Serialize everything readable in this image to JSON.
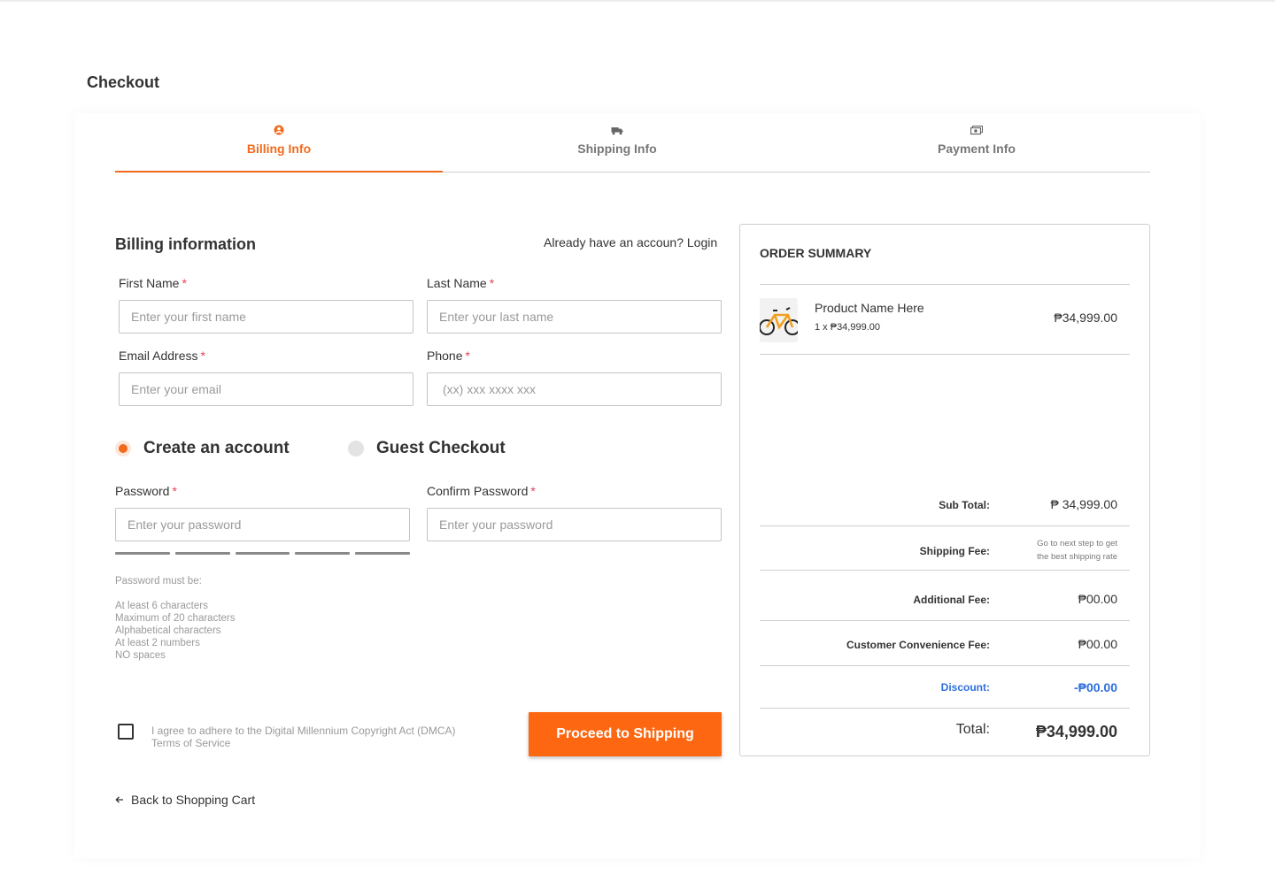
{
  "page": {
    "title": "Checkout"
  },
  "steps": [
    {
      "label": "Billing Info",
      "icon": "user-circle-icon",
      "active": true
    },
    {
      "label": "Shipping Info",
      "icon": "truck-icon",
      "active": false
    },
    {
      "label": "Payment Info",
      "icon": "cash-icon",
      "active": false
    }
  ],
  "colors": {
    "accent": "#f26b1d",
    "button": "#fe6712",
    "discount": "#2f6fdd",
    "required": "#e2445c"
  },
  "billing": {
    "heading": "Billing information",
    "login_prompt": "Already have an accoun? Login",
    "first_name": {
      "label": "First Name",
      "placeholder": "Enter your first name",
      "value": ""
    },
    "last_name": {
      "label": "Last Name",
      "placeholder": "Enter your last name",
      "value": ""
    },
    "email": {
      "label": "Email Address",
      "placeholder": "Enter your email",
      "value": ""
    },
    "phone": {
      "label": "Phone",
      "placeholder": "(xx) xxx xxxx xxx",
      "value": ""
    },
    "required_mark": "*",
    "account_options": [
      {
        "label": "Create an account",
        "selected": true
      },
      {
        "label": "Guest Checkout",
        "selected": false
      }
    ],
    "password": {
      "label": "Password",
      "placeholder": "Enter your password",
      "value": ""
    },
    "confirm_password": {
      "label": "Confirm Password",
      "placeholder": "Enter your password",
      "value": ""
    },
    "password_rules": {
      "title": "Password must be:",
      "items": [
        "At least 6 characters",
        "Maximum of 20 characters",
        "Alphabetical characters",
        "At least 2 numbers",
        "NO spaces"
      ]
    },
    "agreement": {
      "line1": "I agree to adhere to the Digital Millennium Copyright Act (DMCA)",
      "line2": "Terms of Service",
      "checked": false
    },
    "proceed_button": "Proceed to Shipping",
    "back_link": "Back to Shopping Cart"
  },
  "summary": {
    "title": "ORDER SUMMARY",
    "product": {
      "name": "Product Name Here",
      "qty_line": "1 x ₱34,999.00",
      "price": "₱34,999.00",
      "image": "bicycle-thumbnail"
    },
    "subtotal": {
      "label": "Sub Total:",
      "value": "₱ 34,999.00"
    },
    "shipping": {
      "label": "Shipping Fee:",
      "note_line1": "Go to next step to get",
      "note_line2": "the best shipping rate"
    },
    "additional": {
      "label": "Additional Fee:",
      "value": "₱00.00"
    },
    "convenience": {
      "label": "Customer Convenience Fee:",
      "value": "₱00.00"
    },
    "discount": {
      "label": "Discount:",
      "value": "-₱00.00"
    },
    "total": {
      "label": "Total:",
      "value": "₱34,999.00"
    }
  }
}
